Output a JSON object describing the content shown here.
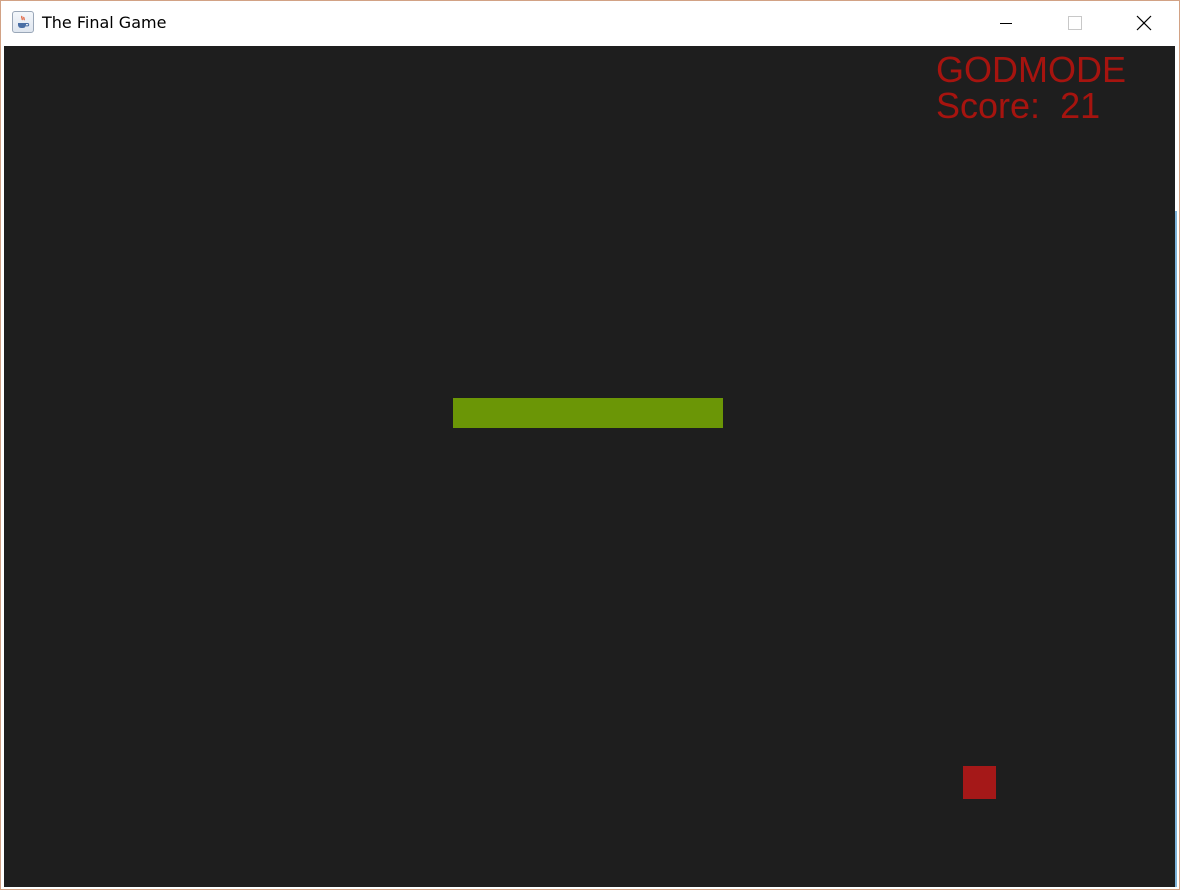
{
  "window": {
    "title": "The Final Game",
    "icon": "java-cup-icon",
    "controls": [
      "minimize-icon",
      "maximize-icon",
      "close-icon"
    ]
  },
  "hud": {
    "mode": "GODMODE",
    "score_label": "Score:",
    "score": 21
  },
  "colors": {
    "background": "#1e1e1e",
    "hud_text": "#a6140f",
    "player_bar": "#6b9606",
    "target_block": "#a51818"
  }
}
